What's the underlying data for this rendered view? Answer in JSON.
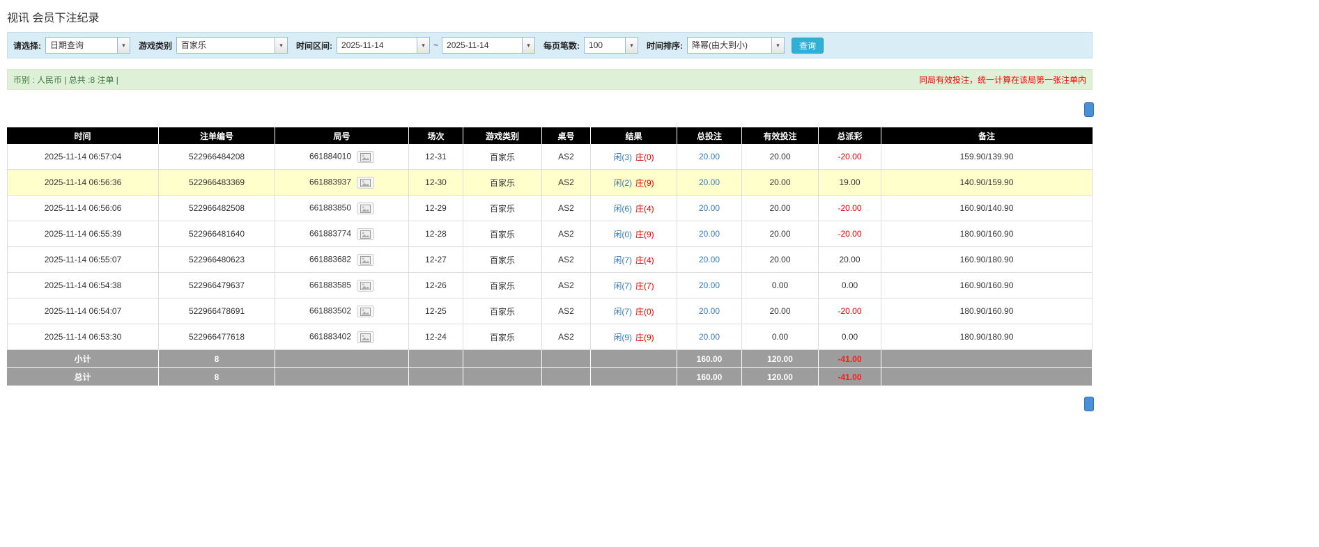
{
  "page": {
    "title": "视讯 会员下注纪录"
  },
  "icons": {
    "caret": "▾"
  },
  "filters": {
    "select_label": "请选择:",
    "select_value": "日期查询",
    "game_type_label": "游戏类别",
    "game_type_value": "百家乐",
    "date_range_label": "时间区间:",
    "date_from": "2025-11-14",
    "date_separator": "~",
    "date_to": "2025-11-14",
    "page_size_label": "每页笔数:",
    "page_size_value": "100",
    "sort_label": "时间排序:",
    "sort_value": "降幂(由大到小)",
    "search_button": "查询"
  },
  "summary": {
    "left": "币别 : 人民币 | 总共 :8 注单 |",
    "right": "同局有效投注，统一计算在该局第一张注单内"
  },
  "table": {
    "headers": [
      "时间",
      "注单编号",
      "局号",
      "场次",
      "游戏类别",
      "桌号",
      "结果",
      "总投注",
      "有效投注",
      "总派彩",
      "备注"
    ],
    "rows": [
      {
        "time": "2025-11-14 06:57:04",
        "bet_id": "522966484208",
        "round_id": "661884010",
        "session": "12-31",
        "game": "百家乐",
        "table_no": "AS2",
        "result_player": "闲(3)",
        "result_banker": "庄(0)",
        "total_bet": "20.00",
        "valid_bet": "20.00",
        "payout": "-20.00",
        "note": "159.90/139.90",
        "highlighted": false
      },
      {
        "time": "2025-11-14 06:56:36",
        "bet_id": "522966483369",
        "round_id": "661883937",
        "session": "12-30",
        "game": "百家乐",
        "table_no": "AS2",
        "result_player": "闲(2)",
        "result_banker": "庄(9)",
        "total_bet": "20.00",
        "valid_bet": "20.00",
        "payout": "19.00",
        "note": "140.90/159.90",
        "highlighted": true
      },
      {
        "time": "2025-11-14 06:56:06",
        "bet_id": "522966482508",
        "round_id": "661883850",
        "session": "12-29",
        "game": "百家乐",
        "table_no": "AS2",
        "result_player": "闲(6)",
        "result_banker": "庄(4)",
        "total_bet": "20.00",
        "valid_bet": "20.00",
        "payout": "-20.00",
        "note": "160.90/140.90",
        "highlighted": false
      },
      {
        "time": "2025-11-14 06:55:39",
        "bet_id": "522966481640",
        "round_id": "661883774",
        "session": "12-28",
        "game": "百家乐",
        "table_no": "AS2",
        "result_player": "闲(0)",
        "result_banker": "庄(9)",
        "total_bet": "20.00",
        "valid_bet": "20.00",
        "payout": "-20.00",
        "note": "180.90/160.90",
        "highlighted": false
      },
      {
        "time": "2025-11-14 06:55:07",
        "bet_id": "522966480623",
        "round_id": "661883682",
        "session": "12-27",
        "game": "百家乐",
        "table_no": "AS2",
        "result_player": "闲(7)",
        "result_banker": "庄(4)",
        "total_bet": "20.00",
        "valid_bet": "20.00",
        "payout": "20.00",
        "note": "160.90/180.90",
        "highlighted": false
      },
      {
        "time": "2025-11-14 06:54:38",
        "bet_id": "522966479637",
        "round_id": "661883585",
        "session": "12-26",
        "game": "百家乐",
        "table_no": "AS2",
        "result_player": "闲(7)",
        "result_banker": "庄(7)",
        "total_bet": "20.00",
        "valid_bet": "0.00",
        "payout": "0.00",
        "note": "160.90/160.90",
        "highlighted": false
      },
      {
        "time": "2025-11-14 06:54:07",
        "bet_id": "522966478691",
        "round_id": "661883502",
        "session": "12-25",
        "game": "百家乐",
        "table_no": "AS2",
        "result_player": "闲(7)",
        "result_banker": "庄(0)",
        "total_bet": "20.00",
        "valid_bet": "20.00",
        "payout": "-20.00",
        "note": "180.90/160.90",
        "highlighted": false
      },
      {
        "time": "2025-11-14 06:53:30",
        "bet_id": "522966477618",
        "round_id": "661883402",
        "session": "12-24",
        "game": "百家乐",
        "table_no": "AS2",
        "result_player": "闲(9)",
        "result_banker": "庄(9)",
        "total_bet": "20.00",
        "valid_bet": "0.00",
        "payout": "0.00",
        "note": "180.90/180.90",
        "highlighted": false
      }
    ],
    "subtotal": {
      "label": "小计",
      "count": "8",
      "total_bet": "160.00",
      "valid_bet": "120.00",
      "payout": "-41.00"
    },
    "total": {
      "label": "总计",
      "count": "8",
      "total_bet": "160.00",
      "valid_bet": "120.00",
      "payout": "-41.00"
    }
  }
}
